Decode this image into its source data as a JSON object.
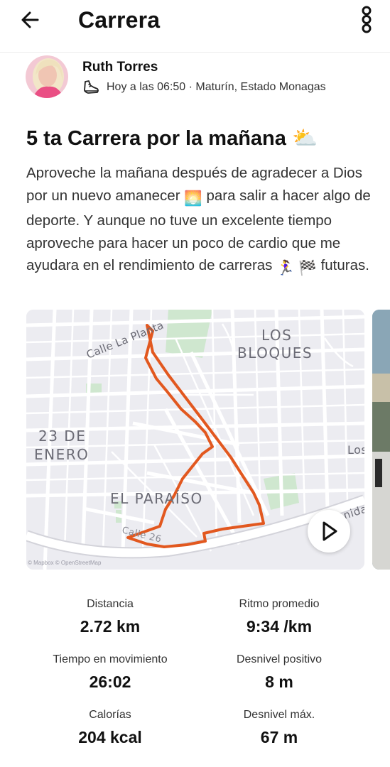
{
  "header": {
    "title": "Carrera",
    "back_icon": "arrow-left-icon",
    "more_icon": "more-vertical-icon"
  },
  "author": {
    "name": "Ruth Torres",
    "meta": "Hoy a las 06:50 · Maturín, Estado Monagas",
    "activity_icon": "running-shoe-icon"
  },
  "activity": {
    "title": "5 ta Carrera por la mañana",
    "title_emoji": "⛅",
    "description_segments": [
      "Aproveche la mañana después de agradecer a Dios por un nuevo amanecer ",
      "🌅",
      " para salir a hacer algo de deporte. Y aunque no tuve un excelente tiempo aproveche para hacer un poco de cardio que me ayudara en el rendimiento de carreras ",
      "🏃‍♀️",
      " ",
      "🏁",
      " futuras."
    ]
  },
  "map": {
    "labels": {
      "street_la_planta": "Calle La Planta",
      "los_bloques_1": "LOS",
      "los_bloques_2": "BLOQUES",
      "enero_1": "23 DE",
      "enero_2": "ENERO",
      "el_paraiso": "EL PARAÍSO",
      "los_partial": "Los",
      "avenida_partial": "nida",
      "street_bottom": "Calle 26"
    },
    "attribution": "© Mapbox © OpenStreetMap",
    "route_color": "#e2581f",
    "play_icon": "play-icon"
  },
  "stats": {
    "distance": {
      "label": "Distancia",
      "value": "2.72 km"
    },
    "pace": {
      "label": "Ritmo promedio",
      "value": "9:34 /km"
    },
    "moving_time": {
      "label": "Tiempo en movimiento",
      "value": "26:02"
    },
    "elevation_gain": {
      "label": "Desnivel positivo",
      "value": "8 m"
    },
    "calories": {
      "label": "Calorías",
      "value": "204 kcal"
    },
    "max_elevation": {
      "label": "Desnivel máx.",
      "value": "67 m"
    }
  }
}
